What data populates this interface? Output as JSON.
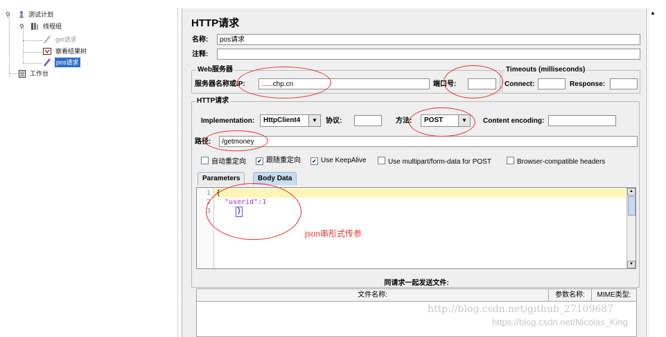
{
  "tree": {
    "items": [
      {
        "label": "测试计划"
      },
      {
        "label": "线程组"
      },
      {
        "label": "get请求"
      },
      {
        "label": "察看结果树"
      },
      {
        "label": "pos请求"
      },
      {
        "label": "工作台"
      }
    ]
  },
  "sampler": {
    "title": "HTTP请求",
    "name_label": "名称:",
    "name_value": "pos请求",
    "comment_label": "注释:",
    "comment_value": "",
    "web_server": {
      "legend": "Web服务器",
      "server_label": "服务器名称或IP:",
      "server_value": "......chp.cn",
      "port_label": "端口号:",
      "port_value": ""
    },
    "timeouts": {
      "legend": "Timeouts (milliseconds)",
      "connect_label": "Connect:",
      "connect_value": "",
      "response_label": "Response:",
      "response_value": ""
    },
    "http_request": {
      "legend": "HTTP请求",
      "implementation_label": "Implementation:",
      "implementation_value": "HttpClient4",
      "protocol_label": "协议:",
      "protocol_value": "",
      "method_label": "方法:",
      "method_value": "POST",
      "encoding_label": "Content encoding:",
      "encoding_value": "",
      "path_label": "路径:",
      "path_value": "/getmoney"
    },
    "options": [
      {
        "label": "自动重定向",
        "checked": false
      },
      {
        "label": "跟随重定向",
        "checked": true
      },
      {
        "label": "Use KeepAlive",
        "checked": true
      },
      {
        "label": "Use multipart/form-data for POST",
        "checked": false
      },
      {
        "label": "Browser-compatible headers",
        "checked": false
      }
    ],
    "tabs": [
      {
        "label": "Parameters"
      },
      {
        "label": "Body Data"
      }
    ],
    "body_lines": [
      {
        "num": "1",
        "text": "{"
      },
      {
        "num": "2",
        "text": "  \"userid\":1"
      },
      {
        "num": "3",
        "text": "}"
      }
    ],
    "annotation": "json串形式传参",
    "files_title": "同请求一起发送文件:",
    "files_columns": [
      "文件名称:",
      "参数名称:",
      "MIME类型:"
    ]
  },
  "watermarks": [
    "http://blog.csdn.net/github_27109687",
    "https://blog.csdn.net/Nicolas_King"
  ],
  "colors": {
    "annotation_red": "#e4342d",
    "selection_blue": "#2f6fc4",
    "highlight_yellow": "#fbf6b7"
  }
}
